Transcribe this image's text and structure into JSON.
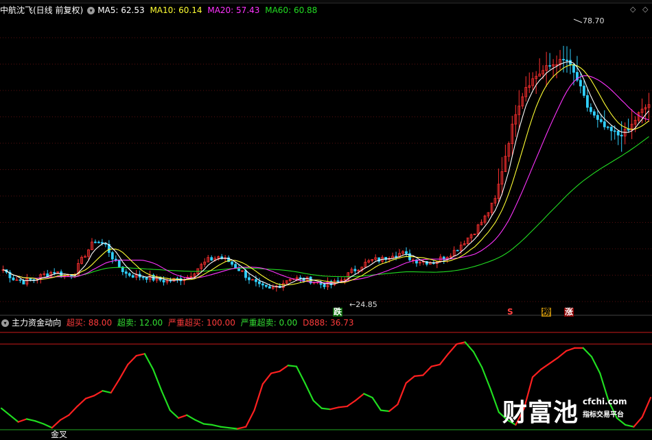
{
  "main_header": {
    "title": "中航沈飞(日线 前复权)",
    "ma5_label": "MA5:",
    "ma5_value": "62.53",
    "ma10_label": "MA10:",
    "ma10_value": "60.14",
    "ma20_label": "MA20:",
    "ma20_value": "57.43",
    "ma60_label": "MA60:",
    "ma60_value": "60.88"
  },
  "indicator_header": {
    "title": "主力资金动向",
    "items": [
      {
        "label": "超买:",
        "value": "88.00",
        "color": "#ff3b3b"
      },
      {
        "label": "超卖:",
        "value": "12.00",
        "color": "#33e033"
      },
      {
        "label": "严重超买:",
        "value": "100.00",
        "color": "#ff3b3b"
      },
      {
        "label": "严重超卖:",
        "value": "0.00",
        "color": "#33e033"
      },
      {
        "label": "D888:",
        "value": "36.73",
        "color": "#ff3b3b"
      }
    ]
  },
  "price_labels": {
    "low": "24.85",
    "high": "78.70"
  },
  "signals": {
    "die": "跌",
    "s": "S",
    "bang": "榜",
    "zhang": "涨"
  },
  "cross_label": "金叉",
  "watermark": {
    "brand": "财富池",
    "url": "cfchi.com",
    "slogan": "指标交易平台"
  },
  "colors": {
    "up": "#ff3030",
    "down": "#30d0ff",
    "ma5": "#ffffff",
    "ma10": "#ffff33",
    "ma20": "#ff33ff",
    "ma60": "#22dd22",
    "grid": "#5a1010",
    "overbought_line": "#cc1a1a"
  },
  "chart_data": {
    "type": "candlestick",
    "symbol": "中航沈飞",
    "period": "日线 前复权",
    "annotated_low": 24.85,
    "annotated_high": 78.7,
    "latest_ma": {
      "MA5": 62.53,
      "MA10": 60.14,
      "MA20": 57.43,
      "MA60": 60.88
    },
    "indicator": {
      "name": "主力资金动向",
      "levels": {
        "超买": 88,
        "超卖": 12,
        "严重超买": 100,
        "严重超卖": 0
      },
      "latest_D888": 36.73,
      "d888_series": [
        22,
        15,
        8,
        11,
        9,
        6,
        2,
        10,
        15,
        24,
        32,
        35,
        40,
        38,
        52,
        67,
        76,
        78,
        62,
        40,
        20,
        12,
        15,
        10,
        6,
        5,
        3,
        2,
        1,
        3,
        20,
        47,
        58,
        60,
        66,
        65,
        48,
        30,
        22,
        21,
        23,
        24,
        30,
        37,
        33,
        20,
        19,
        26,
        48,
        55,
        56,
        65,
        67,
        78,
        88,
        90,
        80,
        64,
        42,
        18,
        10,
        5,
        22,
        54,
        62,
        68,
        74,
        81,
        84,
        84,
        75,
        58,
        30,
        12,
        5,
        3,
        13,
        33
      ]
    },
    "price_series": [
      30.5,
      28.8,
      28.2,
      28.6,
      29.5,
      30.2,
      29.2,
      30.0,
      33.5,
      36.2,
      35.2,
      31.8,
      29.7,
      29.3,
      29.1,
      28.6,
      28.3,
      28.6,
      29.1,
      30.8,
      32.3,
      33.0,
      32.1,
      30.6,
      28.8,
      27.2,
      26.6,
      27.6,
      29.0,
      28.6,
      28.5,
      27.7,
      27.6,
      28.5,
      30.1,
      31.4,
      32.3,
      32.5,
      33.6,
      33.6,
      32.4,
      32.1,
      32.0,
      32.9,
      34.1,
      36.0,
      38.0,
      40.6,
      44.0,
      52.6,
      61.0,
      66.0,
      68.0,
      69.5,
      70.6,
      71.0,
      67.2,
      62.0,
      59.2,
      57.5,
      56.6,
      57.4,
      60.6,
      62.5
    ]
  }
}
